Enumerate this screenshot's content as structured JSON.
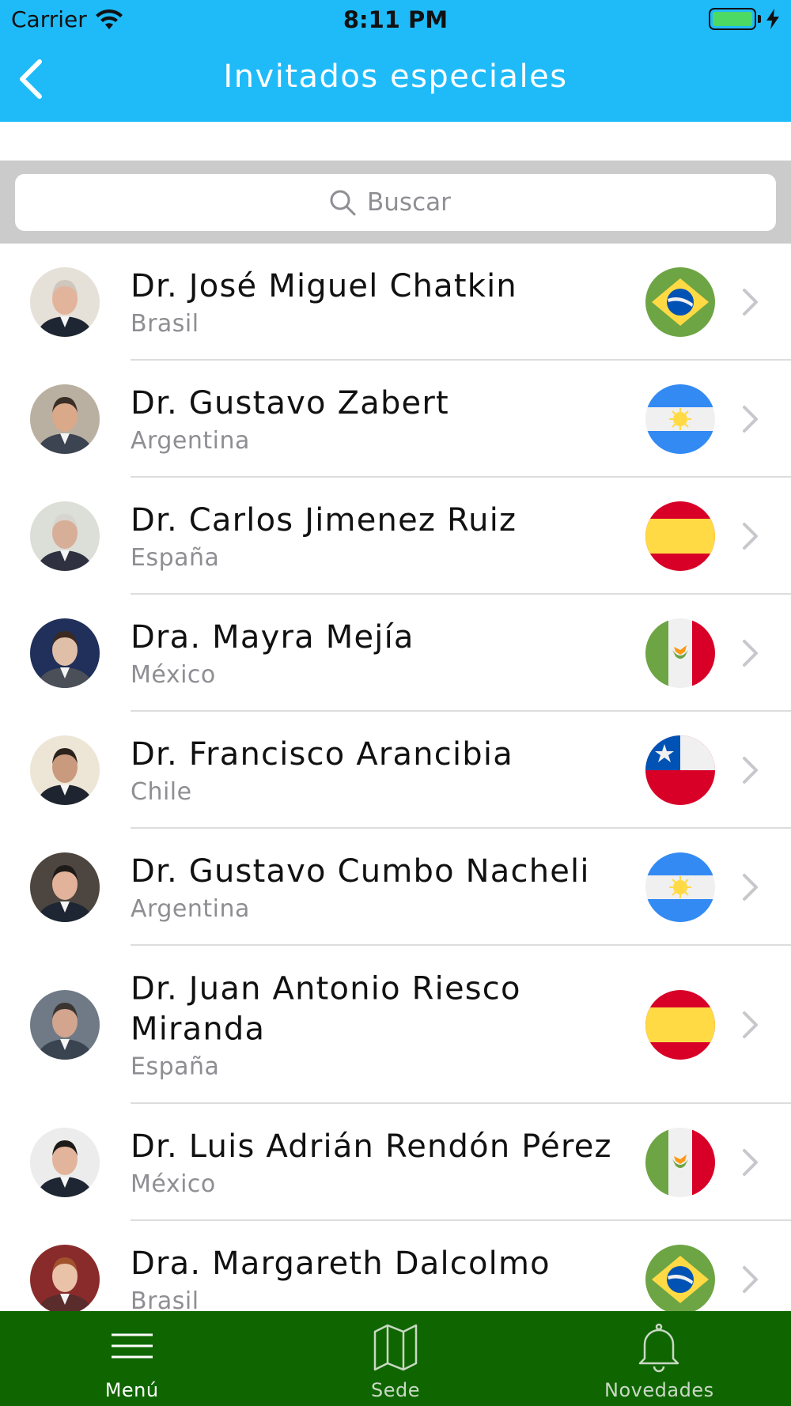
{
  "status_bar": {
    "carrier": "Carrier",
    "time": "8:11 PM"
  },
  "nav": {
    "title": "Invitados especiales",
    "back_icon": "chevron-left-icon"
  },
  "search": {
    "placeholder": "Buscar",
    "icon": "search-icon"
  },
  "guests": [
    {
      "name": "Dr. José Miguel Chatkin",
      "country": "Brasil",
      "flag": "brazil"
    },
    {
      "name": "Dr. Gustavo Zabert",
      "country": "Argentina",
      "flag": "argentina"
    },
    {
      "name": "Dr. Carlos Jimenez Ruiz",
      "country": "España",
      "flag": "spain"
    },
    {
      "name": "Dra. Mayra Mejía",
      "country": "México",
      "flag": "mexico"
    },
    {
      "name": "Dr. Francisco Arancibia",
      "country": "Chile",
      "flag": "chile"
    },
    {
      "name": "Dr. Gustavo Cumbo Nacheli",
      "country": "Argentina",
      "flag": "argentina"
    },
    {
      "name": "Dr. Juan Antonio Riesco Miranda",
      "country": "España",
      "flag": "spain"
    },
    {
      "name": "Dr. Luis Adrián Rendón Pérez",
      "country": "México",
      "flag": "mexico"
    },
    {
      "name": "Dra. Margareth Dalcolmo",
      "country": "Brasil",
      "flag": "brazil"
    }
  ],
  "tabbar": {
    "tabs": [
      {
        "label": "Menú",
        "icon": "menu-icon",
        "active": true
      },
      {
        "label": "Sede",
        "icon": "map-icon",
        "active": false
      },
      {
        "label": "Novedades",
        "icon": "bell-icon",
        "active": false
      }
    ]
  },
  "colors": {
    "header": "#1FBBF9",
    "tabbar": "#0F6600",
    "search_band": "#CBCBCB"
  }
}
